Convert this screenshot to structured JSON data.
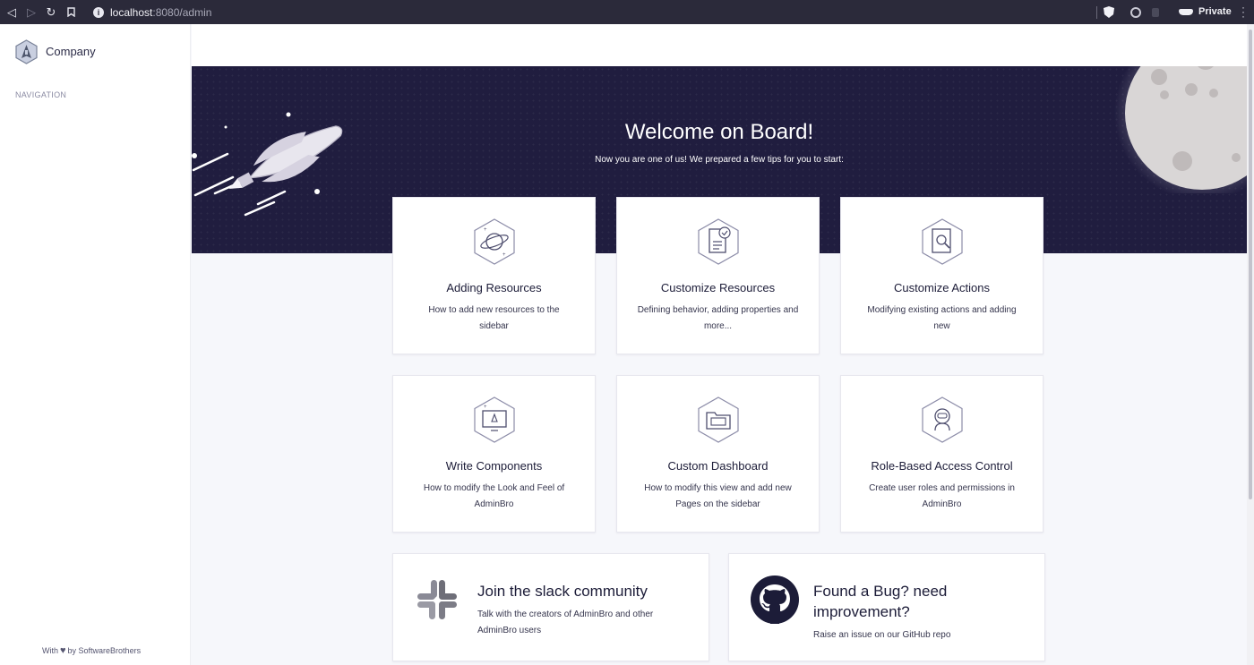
{
  "browser": {
    "url_host": "localhost",
    "url_path": ":8080/admin",
    "private_label": "Private"
  },
  "sidebar": {
    "company": "Company",
    "navigation_heading": "NAVIGATION",
    "footer_prefix": "With",
    "footer_suffix": "by SoftwareBrothers"
  },
  "hero": {
    "title": "Welcome on Board!",
    "subtitle": "Now you are one of us! We prepared a few tips for you to start:"
  },
  "cards": [
    {
      "title": "Adding Resources",
      "description": "How to add new resources to the sidebar",
      "icon": "planet-icon"
    },
    {
      "title": "Customize Resources",
      "description": "Defining behavior, adding properties and more...",
      "icon": "document-check-icon"
    },
    {
      "title": "Customize Actions",
      "description": "Modifying existing actions and adding new",
      "icon": "document-search-icon"
    },
    {
      "title": "Write Components",
      "description": "How to modify the Look and Feel of AdminBro",
      "icon": "monitor-icon"
    },
    {
      "title": "Custom Dashboard",
      "description": "How to modify this view and add new Pages on the sidebar",
      "icon": "folder-icon"
    },
    {
      "title": "Role-Based Access Control",
      "description": "Create user roles and permissions in AdminBro",
      "icon": "astronaut-icon"
    }
  ],
  "community": {
    "slack_title": "Join the slack community",
    "slack_desc": "Talk with the creators of AdminBro and other AdminBro users",
    "github_title_line1": "Found a Bug? need",
    "github_title_line2": "improvement?",
    "github_desc": "Raise an issue on our GitHub repo"
  },
  "colors": {
    "hero_bg": "#201d3f",
    "page_bg": "#f6f7fb",
    "text_dark": "#1c1c38"
  }
}
